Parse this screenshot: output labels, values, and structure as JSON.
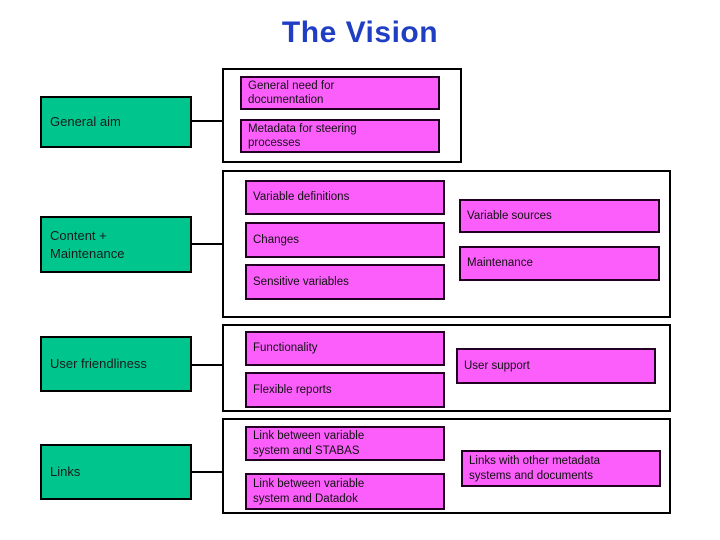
{
  "slide": {
    "title": "The Vision",
    "title_color": "#1f3ec4",
    "background": "#ffffff",
    "category_color": "#00c68e",
    "item_color": "#fb5efb",
    "border_color": "#000000"
  },
  "rows": [
    {
      "category": "General aim",
      "left_items": [
        "General need for\ndocumentation",
        "Metadata for steering\nprocesses"
      ],
      "right_items": []
    },
    {
      "category": "Content +\nMaintenance",
      "left_items": [
        "Variable definitions",
        "Changes",
        "Sensitive variables"
      ],
      "right_items": [
        "Variable sources",
        "Maintenance"
      ]
    },
    {
      "category": "User friendliness",
      "left_items": [
        "Functionality",
        "Flexible reports"
      ],
      "right_items": [
        "User support"
      ]
    },
    {
      "category": "Links",
      "left_items": [
        "Link between variable\nsystem and STABAS",
        "Link between variable\nsystem and Datadok"
      ],
      "right_items": [
        "Links with other metadata\nsystems and documents"
      ]
    }
  ]
}
